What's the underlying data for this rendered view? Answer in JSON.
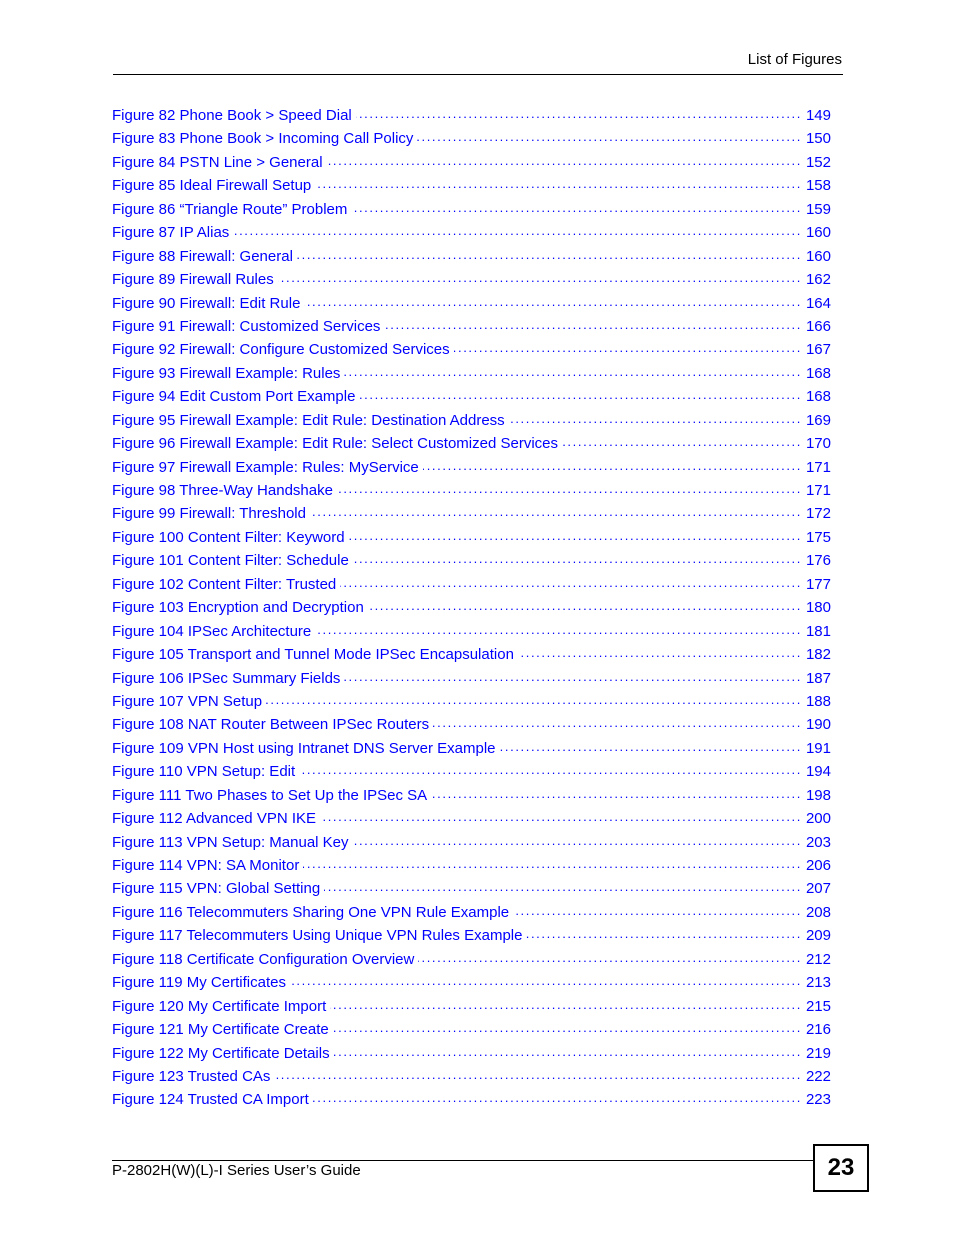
{
  "header": {
    "section_title": "List of Figures"
  },
  "toc": {
    "link_color": "#0000ff",
    "entries": [
      {
        "label": "Figure 82 Phone Book > Speed Dial",
        "page": "149"
      },
      {
        "label": "Figure 83 Phone Book > Incoming Call Policy",
        "page": "150"
      },
      {
        "label": "Figure 84 PSTN Line > General",
        "page": "152"
      },
      {
        "label": "Figure 85 Ideal Firewall Setup",
        "page": "158"
      },
      {
        "label": "Figure 86 “Triangle Route” Problem",
        "page": "159"
      },
      {
        "label": "Figure 87 IP Alias",
        "page": "160"
      },
      {
        "label": "Figure 88 Firewall: General",
        "page": "160"
      },
      {
        "label": "Figure 89 Firewall Rules",
        "page": "162"
      },
      {
        "label": "Figure 90 Firewall: Edit Rule",
        "page": "164"
      },
      {
        "label": "Figure 91 Firewall: Customized Services",
        "page": "166"
      },
      {
        "label": "Figure 92 Firewall: Configure Customized Services",
        "page": "167"
      },
      {
        "label": "Figure 93 Firewall Example: Rules",
        "page": "168"
      },
      {
        "label": "Figure 94 Edit Custom Port Example",
        "page": "168"
      },
      {
        "label": "Figure 95 Firewall Example: Edit Rule: Destination Address",
        "page": "169"
      },
      {
        "label": "Figure 96 Firewall Example: Edit Rule: Select Customized Services",
        "page": "170"
      },
      {
        "label": "Figure 97 Firewall Example: Rules: MyService",
        "page": "171"
      },
      {
        "label": "Figure 98 Three-Way Handshake",
        "page": "171"
      },
      {
        "label": "Figure 99 Firewall: Threshold",
        "page": "172"
      },
      {
        "label": "Figure 100 Content Filter: Keyword",
        "page": "175"
      },
      {
        "label": "Figure 101 Content Filter: Schedule",
        "page": "176"
      },
      {
        "label": "Figure 102 Content Filter: Trusted",
        "page": "177"
      },
      {
        "label": "Figure 103 Encryption and Decryption",
        "page": "180"
      },
      {
        "label": "Figure 104 IPSec Architecture",
        "page": "181"
      },
      {
        "label": "Figure 105 Transport and Tunnel Mode IPSec Encapsulation",
        "page": "182"
      },
      {
        "label": "Figure 106 IPSec Summary Fields",
        "page": "187"
      },
      {
        "label": "Figure 107 VPN Setup",
        "page": "188"
      },
      {
        "label": "Figure 108 NAT Router Between IPSec Routers",
        "page": "190"
      },
      {
        "label": "Figure 109 VPN Host using Intranet DNS Server Example",
        "page": "191"
      },
      {
        "label": "Figure 110 VPN Setup: Edit",
        "page": "194"
      },
      {
        "label": "Figure 111 Two Phases to Set Up the IPSec SA",
        "page": "198"
      },
      {
        "label": "Figure 112 Advanced VPN IKE",
        "page": "200"
      },
      {
        "label": "Figure 113 VPN Setup: Manual Key",
        "page": "203"
      },
      {
        "label": "Figure 114 VPN: SA Monitor",
        "page": "206"
      },
      {
        "label": "Figure 115 VPN: Global Setting",
        "page": "207"
      },
      {
        "label": "Figure 116 Telecommuters Sharing One VPN Rule Example",
        "page": "208"
      },
      {
        "label": "Figure 117 Telecommuters Using Unique VPN Rules Example",
        "page": "209"
      },
      {
        "label": "Figure 118 Certificate Configuration Overview",
        "page": "212"
      },
      {
        "label": "Figure 119 My Certificates",
        "page": "213"
      },
      {
        "label": "Figure 120 My Certificate Import",
        "page": "215"
      },
      {
        "label": "Figure 121 My Certificate Create",
        "page": "216"
      },
      {
        "label": "Figure 122 My Certificate Details",
        "page": "219"
      },
      {
        "label": "Figure 123 Trusted CAs",
        "page": "222"
      },
      {
        "label": "Figure 124 Trusted CA Import",
        "page": "223"
      }
    ]
  },
  "footer": {
    "guide_title": "P-2802H(W)(L)-I Series User’s Guide",
    "page_number": "23"
  }
}
